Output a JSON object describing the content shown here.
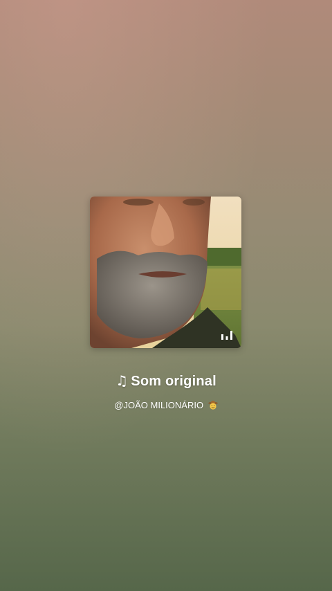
{
  "sound": {
    "music_icon": "♫",
    "title": "Som original",
    "author": "@JOÃO MILIONÁRIO",
    "author_emoji": "cowboy-hat-face-emoji"
  },
  "cover": {
    "description_icon": "sound-wave-bars-icon"
  },
  "colors": {
    "bg_top": "#b08a7a",
    "bg_bottom": "#56674a",
    "text": "#ffffff"
  }
}
